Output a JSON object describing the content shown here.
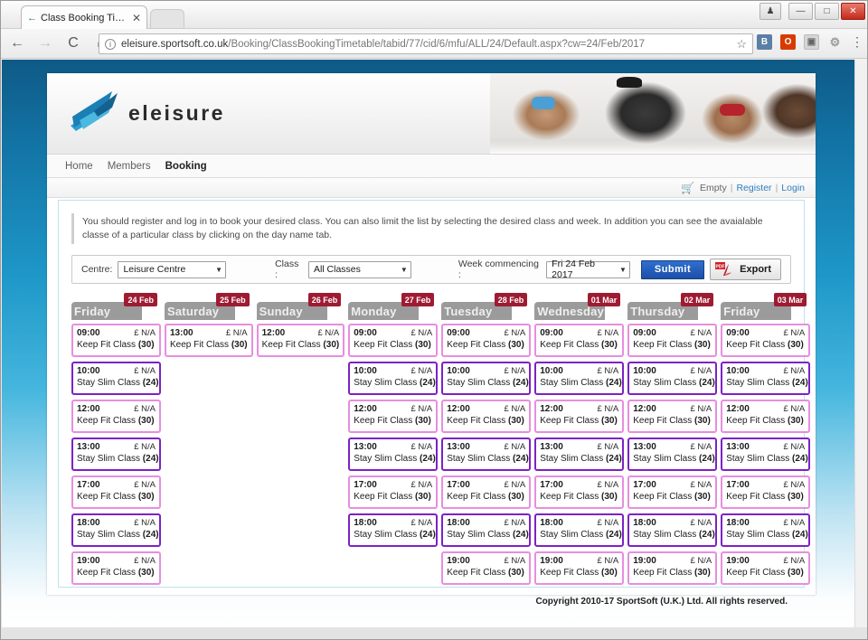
{
  "browser": {
    "tab_title": "Class Booking Timetable",
    "tab_back_icon": "back-arrow-icon",
    "tab_close_label": "✕",
    "url_secure_text": "eleisure.sportsoft.co.uk",
    "url_path": "/Booking/ClassBookingTimetable/tabid/77/cid/6/mfu/ALL/24/Default.aspx?cw=24/Feb/2017",
    "back_label": "←",
    "forward_label": "→",
    "reload_label": "C",
    "home_label": "⌂",
    "star_label": "☆",
    "ext_b_label": "B",
    "ext_o_label": "O",
    "ext_g_label": "▣",
    "ext_p_label": "⚙",
    "menu_label": "⋮",
    "win_person": "♟",
    "win_minimize": "—",
    "win_maximize": "□",
    "win_close": "✕"
  },
  "site": {
    "logo_text": "eleisure",
    "nav": [
      {
        "label": "Home",
        "active": false
      },
      {
        "label": "Members",
        "active": false
      },
      {
        "label": "Booking",
        "active": true
      }
    ],
    "account": {
      "cart_icon": "shopping-cart-icon",
      "cart_status": "Empty",
      "separator": "|",
      "register_label": "Register",
      "login_label": "Login"
    },
    "info_note": "You should register and log in to book your desired class. You can also limit the list by selecting the desired class and week. In addition you can see the avaialable classe of a particular class by clicking on the day name tab.",
    "footer": "Copyright 2010-17 SportSoft (U.K.) Ltd. All rights reserved."
  },
  "filters": {
    "centre_label": "Centre:",
    "centre_value": "Leisure Centre",
    "class_label": "Class :",
    "class_value": "All Classes",
    "week_label": "Week commencing :",
    "week_value": "Fri 24 Feb 2017",
    "submit_label": "Submit",
    "export_label": "Export",
    "export_icon": "pdf-icon",
    "caret": "▼"
  },
  "colors": {
    "keep_fit_border": "#e78ede",
    "stay_slim_border": "#7d22c4",
    "day_tab_bg": "#9b9b9b",
    "date_badge_bg": "#9e1b32",
    "submit_bg": "#1d4fa8",
    "page_bg_top": "#0e5a86"
  },
  "timetable": {
    "price_text": "£ N/A",
    "days": [
      {
        "name": "Friday",
        "date": "24 Feb",
        "slots": [
          {
            "time": "09:00",
            "price": "£ N/A",
            "class_name": "Keep Fit Class",
            "capacity": "(30)",
            "type": "keepfit"
          },
          {
            "time": "10:00",
            "price": "£ N/A",
            "class_name": "Stay Slim Class",
            "capacity": "(24)",
            "type": "stayslim"
          },
          {
            "time": "12:00",
            "price": "£ N/A",
            "class_name": "Keep Fit Class",
            "capacity": "(30)",
            "type": "keepfit"
          },
          {
            "time": "13:00",
            "price": "£ N/A",
            "class_name": "Stay Slim Class",
            "capacity": "(24)",
            "type": "stayslim"
          },
          {
            "time": "17:00",
            "price": "£ N/A",
            "class_name": "Keep Fit Class",
            "capacity": "(30)",
            "type": "keepfit"
          },
          {
            "time": "18:00",
            "price": "£ N/A",
            "class_name": "Stay Slim Class",
            "capacity": "(24)",
            "type": "stayslim"
          },
          {
            "time": "19:00",
            "price": "£ N/A",
            "class_name": "Keep Fit Class",
            "capacity": "(30)",
            "type": "keepfit"
          }
        ]
      },
      {
        "name": "Saturday",
        "date": "25 Feb",
        "slots": [
          {
            "time": "13:00",
            "price": "£ N/A",
            "class_name": "Keep Fit Class",
            "capacity": "(30)",
            "type": "keepfit"
          }
        ]
      },
      {
        "name": "Sunday",
        "date": "26 Feb",
        "slots": [
          {
            "time": "12:00",
            "price": "£ N/A",
            "class_name": "Keep Fit Class",
            "capacity": "(30)",
            "type": "keepfit"
          }
        ]
      },
      {
        "name": "Monday",
        "date": "27 Feb",
        "slots": [
          {
            "time": "09:00",
            "price": "£ N/A",
            "class_name": "Keep Fit Class",
            "capacity": "(30)",
            "type": "keepfit"
          },
          {
            "time": "10:00",
            "price": "£ N/A",
            "class_name": "Stay Slim Class",
            "capacity": "(24)",
            "type": "stayslim"
          },
          {
            "time": "12:00",
            "price": "£ N/A",
            "class_name": "Keep Fit Class",
            "capacity": "(30)",
            "type": "keepfit"
          },
          {
            "time": "13:00",
            "price": "£ N/A",
            "class_name": "Stay Slim Class",
            "capacity": "(24)",
            "type": "stayslim"
          },
          {
            "time": "17:00",
            "price": "£ N/A",
            "class_name": "Keep Fit Class",
            "capacity": "(30)",
            "type": "keepfit"
          },
          {
            "time": "18:00",
            "price": "£ N/A",
            "class_name": "Stay Slim Class",
            "capacity": "(24)",
            "type": "stayslim"
          }
        ]
      },
      {
        "name": "Tuesday",
        "date": "28 Feb",
        "slots": [
          {
            "time": "09:00",
            "price": "£ N/A",
            "class_name": "Keep Fit Class",
            "capacity": "(30)",
            "type": "keepfit"
          },
          {
            "time": "10:00",
            "price": "£ N/A",
            "class_name": "Stay Slim Class",
            "capacity": "(24)",
            "type": "stayslim"
          },
          {
            "time": "12:00",
            "price": "£ N/A",
            "class_name": "Keep Fit Class",
            "capacity": "(30)",
            "type": "keepfit"
          },
          {
            "time": "13:00",
            "price": "£ N/A",
            "class_name": "Stay Slim Class",
            "capacity": "(24)",
            "type": "stayslim"
          },
          {
            "time": "17:00",
            "price": "£ N/A",
            "class_name": "Keep Fit Class",
            "capacity": "(30)",
            "type": "keepfit"
          },
          {
            "time": "18:00",
            "price": "£ N/A",
            "class_name": "Stay Slim Class",
            "capacity": "(24)",
            "type": "stayslim"
          },
          {
            "time": "19:00",
            "price": "£ N/A",
            "class_name": "Keep Fit Class",
            "capacity": "(30)",
            "type": "keepfit"
          }
        ]
      },
      {
        "name": "Wednesday",
        "date": "01 Mar",
        "slots": [
          {
            "time": "09:00",
            "price": "£ N/A",
            "class_name": "Keep Fit Class",
            "capacity": "(30)",
            "type": "keepfit"
          },
          {
            "time": "10:00",
            "price": "£ N/A",
            "class_name": "Stay Slim Class",
            "capacity": "(24)",
            "type": "stayslim"
          },
          {
            "time": "12:00",
            "price": "£ N/A",
            "class_name": "Keep Fit Class",
            "capacity": "(30)",
            "type": "keepfit"
          },
          {
            "time": "13:00",
            "price": "£ N/A",
            "class_name": "Stay Slim Class",
            "capacity": "(24)",
            "type": "stayslim"
          },
          {
            "time": "17:00",
            "price": "£ N/A",
            "class_name": "Keep Fit Class",
            "capacity": "(30)",
            "type": "keepfit"
          },
          {
            "time": "18:00",
            "price": "£ N/A",
            "class_name": "Stay Slim Class",
            "capacity": "(24)",
            "type": "stayslim"
          },
          {
            "time": "19:00",
            "price": "£ N/A",
            "class_name": "Keep Fit Class",
            "capacity": "(30)",
            "type": "keepfit"
          }
        ]
      },
      {
        "name": "Thursday",
        "date": "02 Mar",
        "slots": [
          {
            "time": "09:00",
            "price": "£ N/A",
            "class_name": "Keep Fit Class",
            "capacity": "(30)",
            "type": "keepfit"
          },
          {
            "time": "10:00",
            "price": "£ N/A",
            "class_name": "Stay Slim Class",
            "capacity": "(24)",
            "type": "stayslim"
          },
          {
            "time": "12:00",
            "price": "£ N/A",
            "class_name": "Keep Fit Class",
            "capacity": "(30)",
            "type": "keepfit"
          },
          {
            "time": "13:00",
            "price": "£ N/A",
            "class_name": "Stay Slim Class",
            "capacity": "(24)",
            "type": "stayslim"
          },
          {
            "time": "17:00",
            "price": "£ N/A",
            "class_name": "Keep Fit Class",
            "capacity": "(30)",
            "type": "keepfit"
          },
          {
            "time": "18:00",
            "price": "£ N/A",
            "class_name": "Stay Slim Class",
            "capacity": "(24)",
            "type": "stayslim"
          },
          {
            "time": "19:00",
            "price": "£ N/A",
            "class_name": "Keep Fit Class",
            "capacity": "(30)",
            "type": "keepfit"
          }
        ]
      },
      {
        "name": "Friday",
        "date": "03 Mar",
        "slots": [
          {
            "time": "09:00",
            "price": "£ N/A",
            "class_name": "Keep Fit Class",
            "capacity": "(30)",
            "type": "keepfit"
          },
          {
            "time": "10:00",
            "price": "£ N/A",
            "class_name": "Stay Slim Class",
            "capacity": "(24)",
            "type": "stayslim"
          },
          {
            "time": "12:00",
            "price": "£ N/A",
            "class_name": "Keep Fit Class",
            "capacity": "(30)",
            "type": "keepfit"
          },
          {
            "time": "13:00",
            "price": "£ N/A",
            "class_name": "Stay Slim Class",
            "capacity": "(24)",
            "type": "stayslim"
          },
          {
            "time": "17:00",
            "price": "£ N/A",
            "class_name": "Keep Fit Class",
            "capacity": "(30)",
            "type": "keepfit"
          },
          {
            "time": "18:00",
            "price": "£ N/A",
            "class_name": "Stay Slim Class",
            "capacity": "(24)",
            "type": "stayslim"
          },
          {
            "time": "19:00",
            "price": "£ N/A",
            "class_name": "Keep Fit Class",
            "capacity": "(30)",
            "type": "keepfit"
          }
        ]
      }
    ]
  }
}
